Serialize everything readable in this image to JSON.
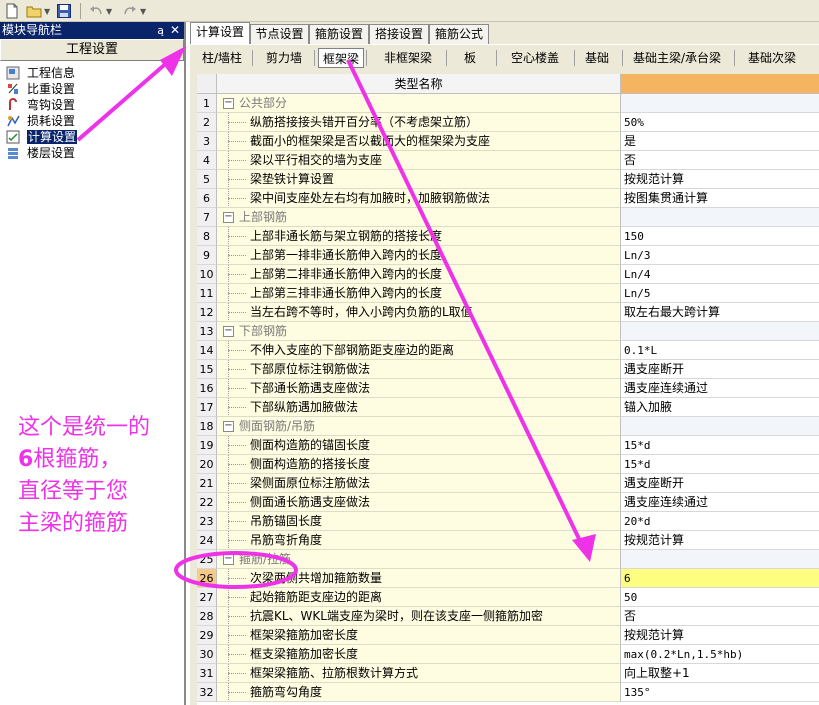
{
  "nav": {
    "title": "模块导航栏",
    "pin_glyph": "ą",
    "close_glyph": "✕",
    "header": "工程设置",
    "items": [
      {
        "label": "工程信息",
        "icon": "info-icon"
      },
      {
        "label": "比重设置",
        "icon": "weight-icon"
      },
      {
        "label": "弯钩设置",
        "icon": "hook-icon"
      },
      {
        "label": "损耗设置",
        "icon": "loss-icon"
      },
      {
        "label": "计算设置",
        "icon": "calc-settings-icon",
        "selected": true
      },
      {
        "label": "楼层设置",
        "icon": "floor-icon"
      }
    ]
  },
  "tabs_top": [
    "计算设置",
    "节点设置",
    "箍筋设置",
    "搭接设置",
    "箍筋公式"
  ],
  "tabs_sub": [
    "柱/墙柱",
    "剪力墙",
    "框架梁",
    "非框架梁",
    "板",
    "空心楼盖",
    "基础",
    "基础主梁/承台梁",
    "基础次梁"
  ],
  "grid": {
    "header_name": "类型名称",
    "rows": [
      {
        "n": "1",
        "name": "公共部分",
        "group": true,
        "value": ""
      },
      {
        "n": "2",
        "name": "纵筋搭接接头错开百分率（不考虑架立筋）",
        "value": "50%"
      },
      {
        "n": "3",
        "name": "截面小的框架梁是否以截面大的框架梁为支座",
        "value": "是"
      },
      {
        "n": "4",
        "name": "梁以平行相交的墙为支座",
        "value": "否"
      },
      {
        "n": "5",
        "name": "梁垫铁计算设置",
        "value": "按规范计算"
      },
      {
        "n": "6",
        "name": "梁中间支座处左右均有加腋时，加腋钢筋做法",
        "value": "按图集贯通计算"
      },
      {
        "n": "7",
        "name": "上部钢筋",
        "group": true,
        "value": ""
      },
      {
        "n": "8",
        "name": "上部非通长筋与架立钢筋的搭接长度",
        "value": "150"
      },
      {
        "n": "9",
        "name": "上部第一排非通长筋伸入跨内的长度",
        "value": "Ln/3"
      },
      {
        "n": "10",
        "name": "上部第二排非通长筋伸入跨内的长度",
        "value": "Ln/4"
      },
      {
        "n": "11",
        "name": "上部第三排非通长筋伸入跨内的长度",
        "value": "Ln/5"
      },
      {
        "n": "12",
        "name": "当左右跨不等时，伸入小跨内负筋的L取值",
        "value": "取左右最大跨计算"
      },
      {
        "n": "13",
        "name": "下部钢筋",
        "group": true,
        "value": ""
      },
      {
        "n": "14",
        "name": "不伸入支座的下部钢筋距支座边的距离",
        "value": "0.1*L"
      },
      {
        "n": "15",
        "name": "下部原位标注钢筋做法",
        "value": "遇支座断开"
      },
      {
        "n": "16",
        "name": "下部通长筋遇支座做法",
        "value": "遇支座连续通过"
      },
      {
        "n": "17",
        "name": "下部纵筋遇加腋做法",
        "value": "锚入加腋"
      },
      {
        "n": "18",
        "name": "侧面钢筋/吊筋",
        "group": true,
        "value": ""
      },
      {
        "n": "19",
        "name": "侧面构造筋的锚固长度",
        "value": "15*d"
      },
      {
        "n": "20",
        "name": "侧面构造筋的搭接长度",
        "value": "15*d"
      },
      {
        "n": "21",
        "name": "梁侧面原位标注筋做法",
        "value": "遇支座断开"
      },
      {
        "n": "22",
        "name": "侧面通长筋遇支座做法",
        "value": "遇支座连续通过"
      },
      {
        "n": "23",
        "name": "吊筋锚固长度",
        "value": "20*d"
      },
      {
        "n": "24",
        "name": "吊筋弯折角度",
        "value": "按规范计算"
      },
      {
        "n": "25",
        "name": "箍筋/拉筋",
        "group": true,
        "value": ""
      },
      {
        "n": "26",
        "name": "次梁两侧共增加箍筋数量",
        "value": "6",
        "selected": true
      },
      {
        "n": "27",
        "name": "起始箍筋距支座边的距离",
        "value": "50"
      },
      {
        "n": "28",
        "name": "抗震KL、WKL端支座为梁时，则在该支座一侧箍筋加密",
        "value": "否"
      },
      {
        "n": "29",
        "name": "框架梁箍筋加密长度",
        "value": "按规范计算"
      },
      {
        "n": "30",
        "name": "框支梁箍筋加密长度",
        "value": "max(0.2*Ln,1.5*hb)"
      },
      {
        "n": "31",
        "name": "框架梁箍筋、拉筋根数计算方式",
        "value": "向上取整+1"
      },
      {
        "n": "32",
        "name": "箍筋弯勾角度",
        "value": "135°"
      }
    ]
  },
  "annotation": {
    "line1": "这个是统一的",
    "line2_num": "6",
    "line2_rest": "根箍筋，",
    "line3": "直径等于您",
    "line4": "主梁的箍筋"
  },
  "colors": {
    "annotation": "#ee32e8",
    "nav_title_bg": "#0a246a",
    "value_header": "#f5b560",
    "selected_value": "#fdfd80"
  }
}
